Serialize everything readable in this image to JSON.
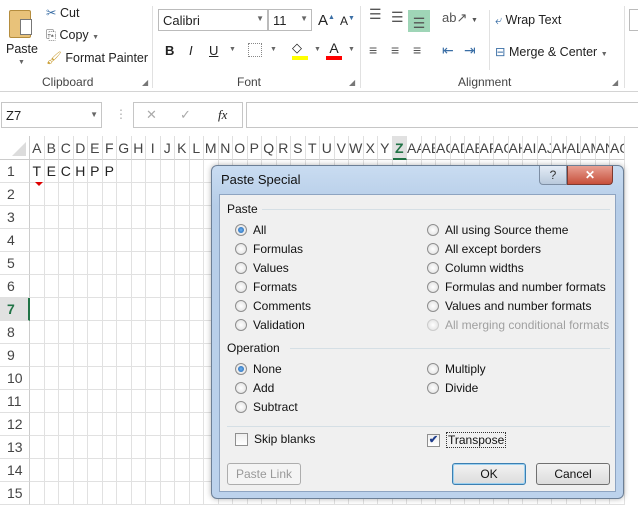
{
  "ribbon": {
    "clipboard": {
      "paste": "Paste",
      "cut": "Cut",
      "copy": "Copy",
      "format_painter": "Format Painter",
      "label": "Clipboard"
    },
    "font": {
      "name": "Calibri",
      "size": "11",
      "bold": "B",
      "italic": "I",
      "underline": "U",
      "label": "Font",
      "highlight_color": "#ffff00",
      "font_color": "#ff0000"
    },
    "alignment": {
      "wrap_text": "Wrap Text",
      "merge_center": "Merge & Center",
      "label": "Alignment",
      "active_color": "#9fd5b7"
    }
  },
  "formula_bar": {
    "name_box": "Z7",
    "cancel": "✕",
    "enter": "✓",
    "fx": "fx",
    "value": ""
  },
  "sheet": {
    "columns": [
      "A",
      "B",
      "C",
      "D",
      "E",
      "F",
      "G",
      "H",
      "I",
      "J",
      "K",
      "L",
      "M",
      "N",
      "O",
      "P",
      "Q",
      "R",
      "S",
      "T",
      "U",
      "V",
      "W",
      "X",
      "Y",
      "Z",
      "AA",
      "AB",
      "AC",
      "AD",
      "AE",
      "AF",
      "AG",
      "AH",
      "AI",
      "AJ",
      "AK",
      "AL",
      "AM",
      "AN",
      "AO"
    ],
    "rows": [
      "1",
      "2",
      "3",
      "4",
      "5",
      "6",
      "7",
      "8",
      "9",
      "10",
      "11",
      "12",
      "13",
      "14",
      "15"
    ],
    "row1": [
      "T",
      "E",
      "C",
      "H",
      "P",
      "P"
    ],
    "active_cell": "Z7",
    "accent": "#217346"
  },
  "dialog": {
    "title": "Paste Special",
    "help": "?",
    "close": "✕",
    "paste_section": "Paste",
    "paste_left": [
      {
        "label": "All",
        "selected": true
      },
      {
        "label": "Formulas"
      },
      {
        "label": "Values"
      },
      {
        "label": "Formats"
      },
      {
        "label": "Comments"
      },
      {
        "label": "Validation"
      }
    ],
    "paste_right": [
      {
        "label": "All using Source theme"
      },
      {
        "label": "All except borders"
      },
      {
        "label": "Column widths"
      },
      {
        "label": "Formulas and number formats"
      },
      {
        "label": "Values and number formats"
      },
      {
        "label": "All merging conditional formats",
        "disabled": true
      }
    ],
    "operation_section": "Operation",
    "op_left": [
      {
        "label": "None",
        "selected": true
      },
      {
        "label": "Add"
      },
      {
        "label": "Subtract"
      }
    ],
    "op_right": [
      {
        "label": "Multiply"
      },
      {
        "label": "Divide"
      }
    ],
    "skip_blanks": {
      "label": "Skip blanks",
      "checked": false
    },
    "transpose": {
      "label": "Transpose",
      "checked": true
    },
    "paste_link": "Paste Link",
    "ok": "OK",
    "cancel": "Cancel"
  }
}
